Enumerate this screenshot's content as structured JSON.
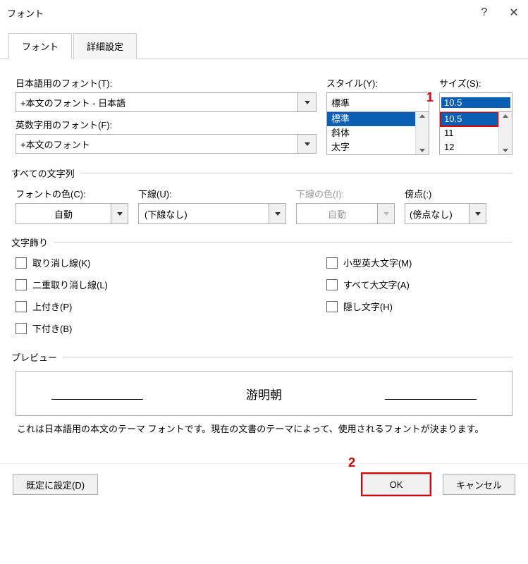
{
  "title": "フォント",
  "tabs": {
    "font": "フォント",
    "advanced": "詳細設定"
  },
  "labels": {
    "jpFont": "日本語用のフォント(T):",
    "latinFont": "英数字用のフォント(F):",
    "style": "スタイル(Y):",
    "size": "サイズ(S):"
  },
  "jpFontValue": "+本文のフォント - 日本語",
  "latinFontValue": "+本文のフォント",
  "styleValue": "標準",
  "styleOptions": [
    "標準",
    "斜体",
    "太字"
  ],
  "sizeValue": "10.5",
  "sizeOptions": [
    "10.5",
    "11",
    "12"
  ],
  "sectionAll": "すべての文字列",
  "fontColorLabel": "フォントの色(C):",
  "fontColorValue": "自動",
  "underlineLabel": "下線(U):",
  "underlineValue": "(下線なし)",
  "underlineColorLabel": "下線の色(I):",
  "underlineColorValue": "自動",
  "emphasisLabel": "傍点(:)",
  "emphasisValue": "(傍点なし)",
  "sectionEffects": "文字飾り",
  "checks": {
    "strike": "取り消し線(K)",
    "dstrike": "二重取り消し線(L)",
    "super": "上付き(P)",
    "sub": "下付き(B)",
    "smallcaps": "小型英大文字(M)",
    "allcaps": "すべて大文字(A)",
    "hidden": "隠し文字(H)"
  },
  "sectionPreview": "プレビュー",
  "previewText": "游明朝",
  "desc": "これは日本語用の本文のテーマ フォントです。現在の文書のテーマによって、使用されるフォントが決まります。",
  "buttons": {
    "default": "既定に設定(D)",
    "ok": "OK",
    "cancel": "キャンセル"
  },
  "annot": {
    "one": "1",
    "two": "2"
  }
}
